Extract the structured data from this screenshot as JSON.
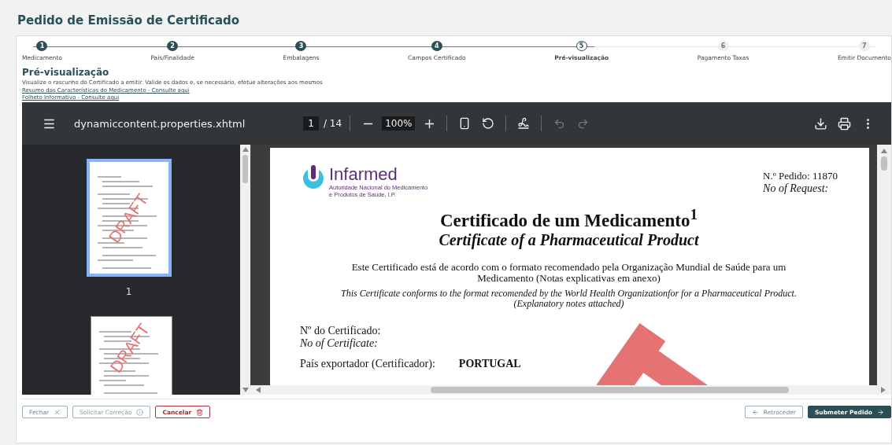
{
  "page_title": "Pedido de Emissão de Certificado",
  "steps": [
    {
      "number": "1",
      "label": "Medicamento",
      "completed": true,
      "selected": false
    },
    {
      "number": "2",
      "label": "País/Finalidade",
      "completed": true,
      "selected": false
    },
    {
      "number": "3",
      "label": "Embalagens",
      "completed": true,
      "selected": false
    },
    {
      "number": "4",
      "label": "Campos Certificado",
      "completed": true,
      "selected": false
    },
    {
      "number": "5",
      "label": "Pré-visualização",
      "completed": false,
      "selected": true
    },
    {
      "number": "6",
      "label": "Pagamento Taxas",
      "completed": false,
      "selected": false
    },
    {
      "number": "7",
      "label": "Emitir Documento",
      "completed": false,
      "selected": false
    }
  ],
  "section": {
    "heading": "Pré-visualização",
    "description": "Visualize o rascunho do Certificado a emitir. Valide os dados e, se necessário, efetue alterações aos mesmos",
    "links": [
      "Resumo das Características do Medicamento - Consulte aqui",
      "Folheto Informativo - Consulte aqui"
    ]
  },
  "viewer": {
    "file_name": "dynamiccontent.properties.xhtml",
    "page": "1",
    "page_count": "/ 14",
    "zoom": "100%",
    "thumbnails": [
      {
        "watermark": "DRAFT",
        "label": "1",
        "selected": true
      },
      {
        "watermark": "DRAFT",
        "selected": false
      }
    ],
    "document": {
      "request_label": "N.º Pedido:",
      "request_number": "11870",
      "request_label_en": "No of Request:",
      "logo_name": "Infarmed",
      "logo_subtitle": [
        "Autoridade Nacional do Medicamento",
        "e Produtos de Saúde, I.P."
      ],
      "title": "Certificado de um Medicamento$^{1}$",
      "subtitle": "Certificate of a Pharmaceutical Product",
      "intro": "Este Certificado está de acordo com o formato recomendado pela Organização Mundial de Saúde para um Medicamento (Notas explicativas em anexo)",
      "intro_en": "This Certificate conforms to the format recomended by the World Health Organizationfor for a Pharmaceutical Product. (Explanatory notes attached)",
      "certificate_label": "Nº do Certificado:",
      "certificate_label_en": "No of Certificate:",
      "country_label": "País exportador (Certificador):",
      "country_value": "PORTUGAL"
    }
  },
  "footer": {
    "left_buttons": [
      {
        "label": "Fechar",
        "kind": "close"
      },
      {
        "label": "Solicitar Correção",
        "kind": "info"
      },
      {
        "label": "Cancelar",
        "kind": "danger"
      }
    ],
    "right_buttons": [
      {
        "label": "Retroceder",
        "kind": "back"
      },
      {
        "label": "Submeter Pedido",
        "kind": "primary"
      }
    ]
  }
}
